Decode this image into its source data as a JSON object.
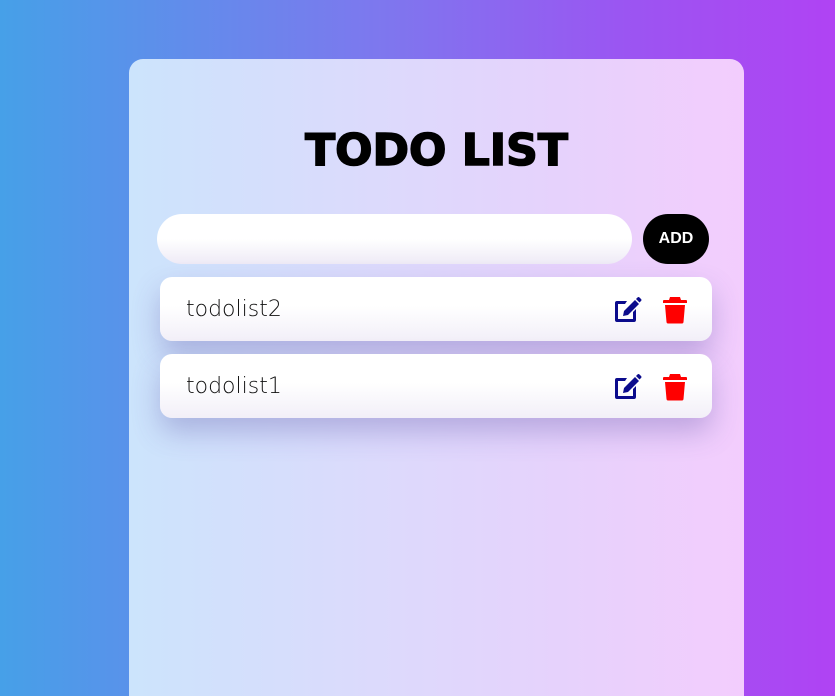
{
  "app": {
    "title": "TODO LIST"
  },
  "input": {
    "value": "",
    "placeholder": ""
  },
  "add_button": {
    "label": "ADD"
  },
  "todos": [
    {
      "text": "todolist2"
    },
    {
      "text": "todolist1"
    }
  ],
  "colors": {
    "edit_icon": "#0b0b8c",
    "delete_icon": "#ff0000",
    "add_button_bg": "#000000",
    "title": "#000000"
  },
  "icons": {
    "edit": "edit-icon",
    "delete": "trash-icon"
  }
}
